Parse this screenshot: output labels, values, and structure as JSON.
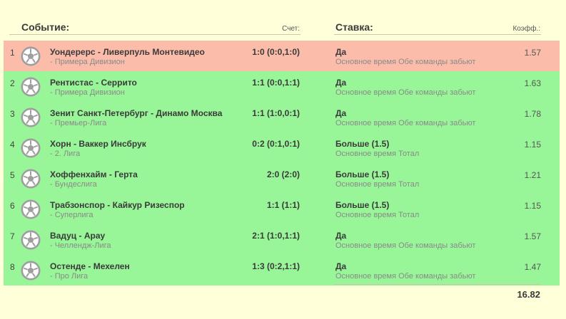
{
  "header": {
    "event_label": "Событие:",
    "score_label": "Счет:",
    "bet_label": "Ставка:",
    "odds_label": "Коэфф.:"
  },
  "rows": [
    {
      "num": "1",
      "event": "Уондерерс - Ливерпуль Монтевидео",
      "league": "- Примера Дивизион",
      "score": "1:0 (0:0,1:0)",
      "bet": "Да",
      "market": "Основное время Обе команды забьют",
      "odds": "1.57",
      "status": "lost"
    },
    {
      "num": "2",
      "event": "Рентистас - Серрито",
      "league": "- Примера Дивизион",
      "score": "1:1 (0:0,1:1)",
      "bet": "Да",
      "market": "Основное время Обе команды забьют",
      "odds": "1.63",
      "status": "won"
    },
    {
      "num": "3",
      "event": "Зенит Санкт-Петербург - Динамо Москва",
      "league": "- Премьер-Лига",
      "score": "1:1 (1:0,0:1)",
      "bet": "Да",
      "market": "Основное время Обе команды забьют",
      "odds": "1.78",
      "status": "won"
    },
    {
      "num": "4",
      "event": "Хорн - Ваккер Инсбрук",
      "league": "- 2. Лига",
      "score": "0:2 (0:1,0:1)",
      "bet": "Больше (1.5)",
      "market": "Основное время Тотал",
      "odds": "1.15",
      "status": "won"
    },
    {
      "num": "5",
      "event": "Хоффенхайм - Герта",
      "league": "- Бундеслига",
      "score": "2:0 (2:0)",
      "bet": "Больше (1.5)",
      "market": "Основное время Тотал",
      "odds": "1.21",
      "status": "won"
    },
    {
      "num": "6",
      "event": "Трабзонспор - Кайкур Ризеспор",
      "league": "- Суперлига",
      "score": "1:1 (1:1)",
      "bet": "Больше (1.5)",
      "market": "Основное время Тотал",
      "odds": "1.15",
      "status": "won"
    },
    {
      "num": "7",
      "event": "Вадуц - Арау",
      "league": "- Челлендж-Лига",
      "score": "2:1 (1:0,1:1)",
      "bet": "Да",
      "market": "Основное время Обе команды забьют",
      "odds": "1.57",
      "status": "won"
    },
    {
      "num": "8",
      "event": "Остенде - Мехелен",
      "league": "- Про Лига",
      "score": "1:3 (0:2,1:1)",
      "bet": "Да",
      "market": "Основное время Обе команды забьют",
      "odds": "1.47",
      "status": "won"
    }
  ],
  "total_odds": "16.82",
  "colors": {
    "background": "#ffffd9",
    "won_row": "#98f598",
    "lost_row": "#fcbcaa",
    "icon": "#9e9e9e"
  },
  "icons": {
    "sport": "soccer-ball-icon"
  }
}
